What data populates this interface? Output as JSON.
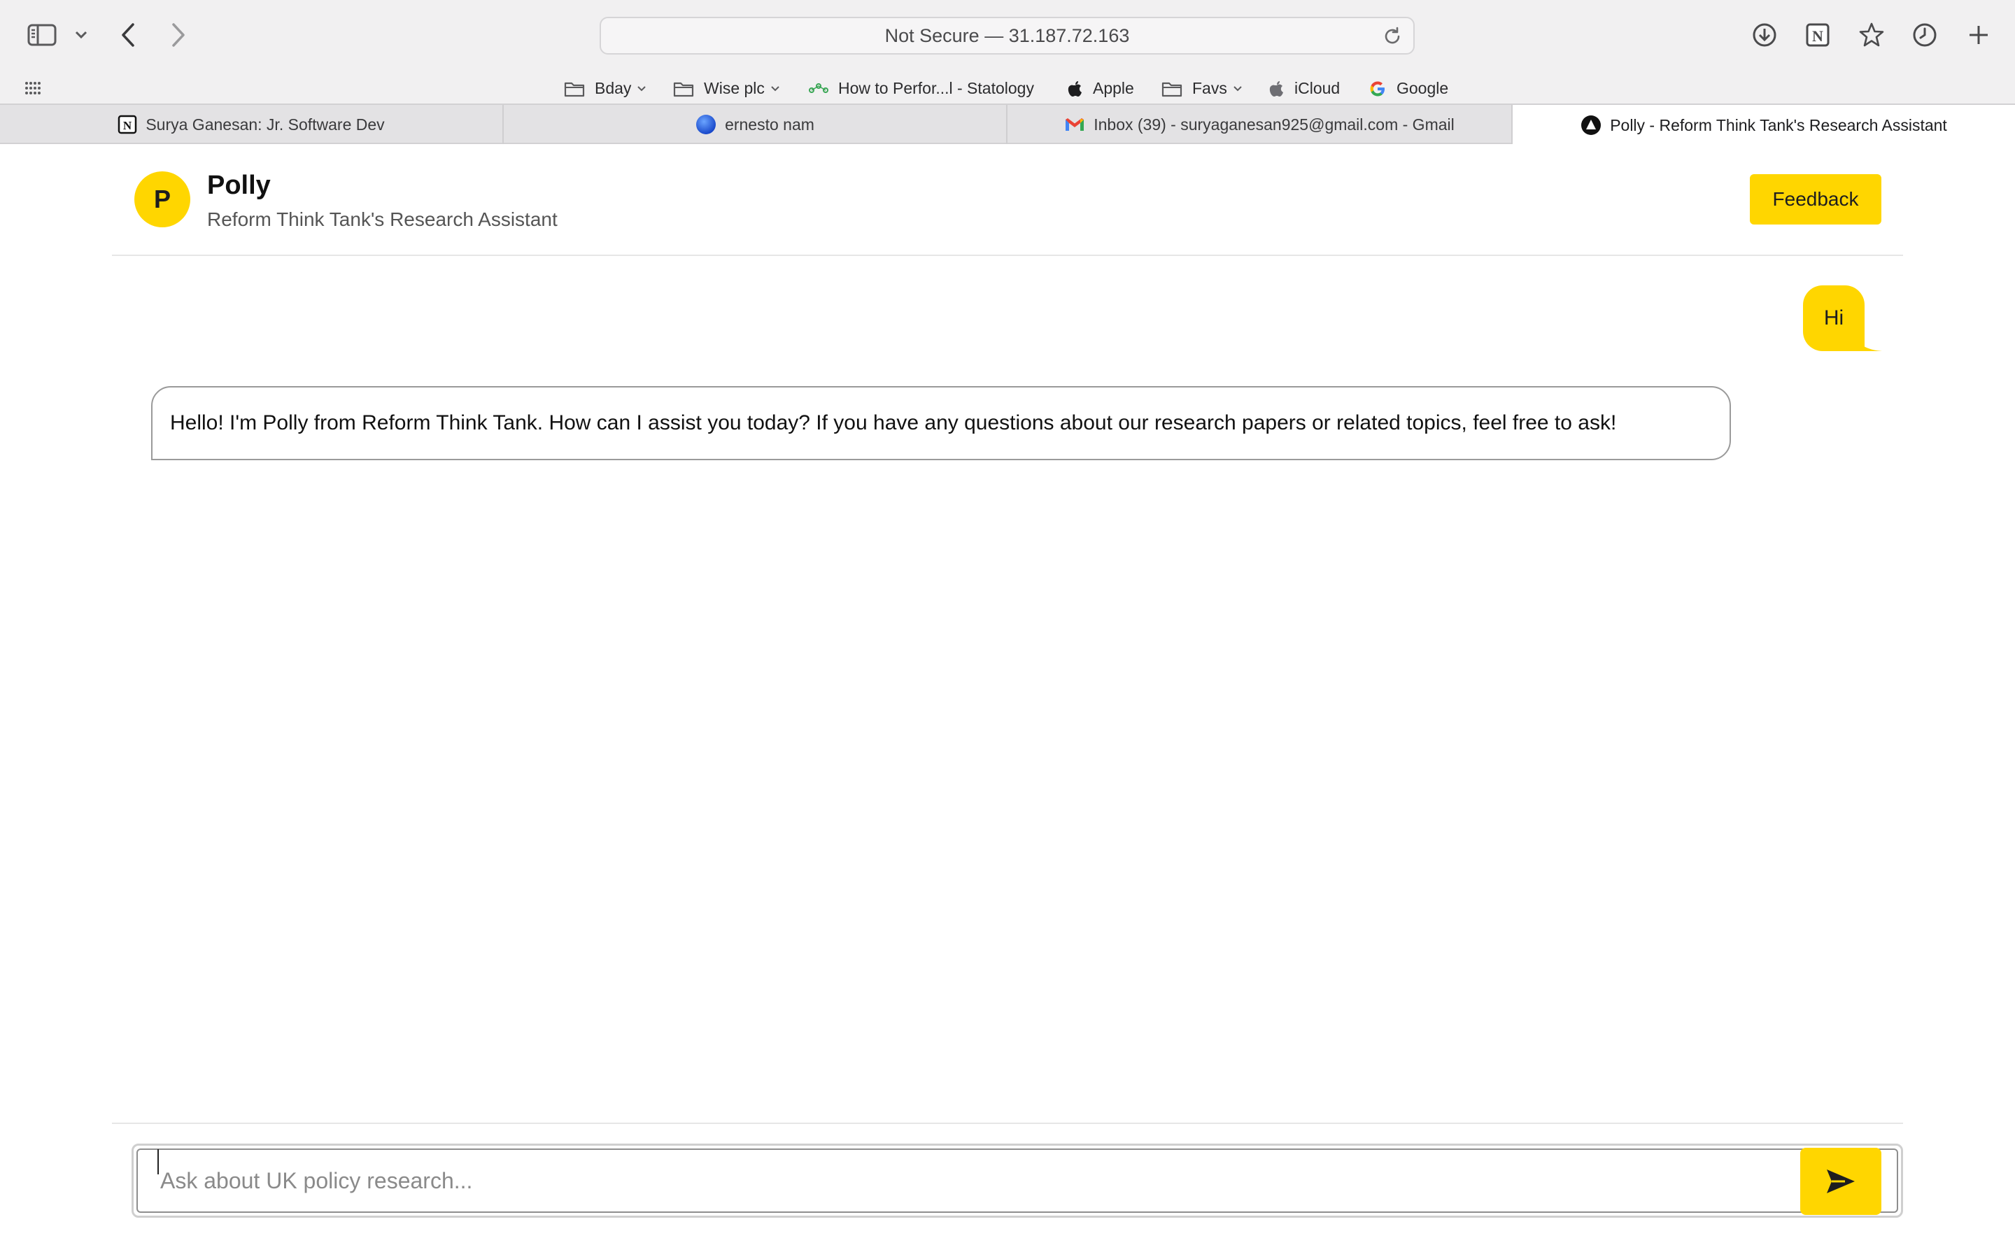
{
  "browser": {
    "address": "Not Secure — 31.187.72.163",
    "bookmarks": [
      {
        "label": "Bday",
        "icon": "folder-icon",
        "has_menu": true
      },
      {
        "label": "Wise plc",
        "icon": "folder-icon",
        "has_menu": true
      },
      {
        "label": "How to Perfor...l - Statology",
        "icon": "statology-icon",
        "has_menu": false
      },
      {
        "label": "Apple",
        "icon": "apple-icon",
        "has_menu": false
      },
      {
        "label": "Favs",
        "icon": "folder-icon",
        "has_menu": true
      },
      {
        "label": "iCloud",
        "icon": "apple-icon",
        "has_menu": false
      },
      {
        "label": "Google",
        "icon": "google-icon",
        "has_menu": false
      }
    ],
    "tabs": [
      {
        "label": "Surya Ganesan: Jr. Software Dev",
        "icon": "notion-icon",
        "active": false
      },
      {
        "label": "ernesto nam",
        "icon": "globe-icon",
        "active": false
      },
      {
        "label": "Inbox (39) - suryaganesan925@gmail.com - Gmail",
        "icon": "gmail-icon",
        "active": false
      },
      {
        "label": "Polly - Reform Think Tank's Research Assistant",
        "icon": "polly-icon",
        "active": true
      }
    ]
  },
  "app": {
    "avatar_letter": "P",
    "title": "Polly",
    "subtitle": "Reform Think Tank's Research Assistant",
    "feedback_label": "Feedback",
    "accent_color": "#ffd600"
  },
  "chat": {
    "messages": [
      {
        "role": "user",
        "text": "Hi"
      },
      {
        "role": "assistant",
        "text": "Hello! I'm Polly from Reform Think Tank. How can I assist you today? If you have any questions about our research papers or related topics, feel free to ask!"
      }
    ],
    "input_placeholder": "Ask about UK policy research...",
    "input_value": ""
  }
}
